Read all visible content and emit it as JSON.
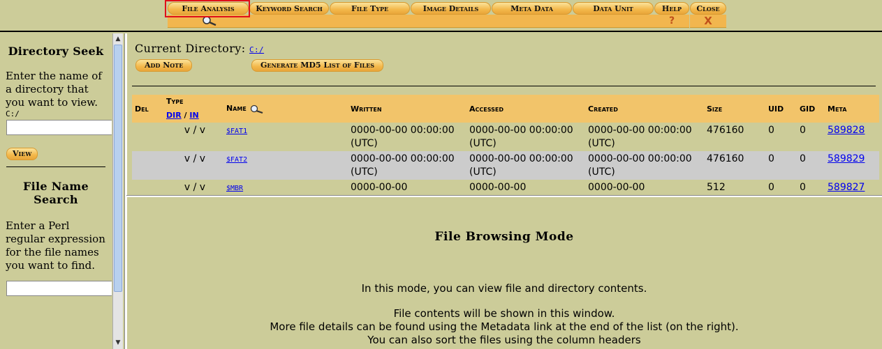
{
  "toolbar": {
    "buttons": [
      {
        "label": "File Analysis",
        "sub": "search"
      },
      {
        "label": "Keyword Search",
        "sub": ""
      },
      {
        "label": "File Type",
        "sub": ""
      },
      {
        "label": "Image Details",
        "sub": ""
      },
      {
        "label": "Meta Data",
        "sub": ""
      },
      {
        "label": "Data Unit",
        "sub": ""
      },
      {
        "label": "Help",
        "sub": "?"
      },
      {
        "label": "Close",
        "sub": "X"
      }
    ],
    "selected": "File Analysis",
    "accent_color": "#f3b84a",
    "highlight_color": "#e0101a"
  },
  "left": {
    "dir_seek": {
      "title": "Directory Seek",
      "prompt": "Enter the name of a directory that you want to view.",
      "path": "C:/",
      "input_value": "",
      "button": "View"
    },
    "name_search": {
      "title": "File Name Search",
      "prompt": "Enter a Perl regular expression for the file names you want to find.",
      "input_value": ""
    }
  },
  "main": {
    "current_dir_label": "Current Directory:",
    "current_dir": "C:/",
    "add_note": "Add Note",
    "md5_button": "Generate MD5 List of Files",
    "columns": {
      "del": "Del",
      "type": "Type",
      "type_dir": "dir",
      "type_sep": "/",
      "type_in": "in",
      "name": "Name",
      "written": "Written",
      "accessed": "Accessed",
      "created": "Created",
      "size": "Size",
      "uid": "UID",
      "gid": "GID",
      "meta": "Meta"
    },
    "rows": [
      {
        "type": "v / v",
        "name": "$FAT1",
        "written": "0000-00-00 00:00:00 (UTC)",
        "accessed": "0000-00-00 00:00:00 (UTC)",
        "created": "0000-00-00 00:00:00 (UTC)",
        "size": "476160",
        "uid": "0",
        "gid": "0",
        "meta": "589828"
      },
      {
        "type": "v / v",
        "name": "$FAT2",
        "written": "0000-00-00 00:00:00 (UTC)",
        "accessed": "0000-00-00 00:00:00 (UTC)",
        "created": "0000-00-00 00:00:00 (UTC)",
        "size": "476160",
        "uid": "0",
        "gid": "0",
        "meta": "589829"
      },
      {
        "type": "v / v",
        "name": "$MBR",
        "written": "0000-00-00",
        "accessed": "0000-00-00",
        "created": "0000-00-00",
        "size": "512",
        "uid": "0",
        "gid": "0",
        "meta": "589827"
      }
    ]
  },
  "info": {
    "title": "File Browsing Mode",
    "line1": "In this mode, you can view file and directory contents.",
    "line2": "File contents will be shown in this window.",
    "line3": "More file details can be found using the Metadata link at the end of the list (on the right).",
    "line4": "You can also sort the files using the column headers"
  }
}
